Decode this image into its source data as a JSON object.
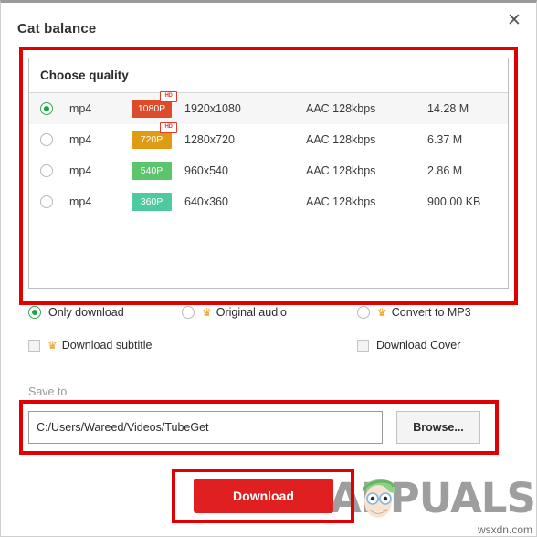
{
  "window": {
    "title": "Cat  balance",
    "close_icon": "close-icon"
  },
  "quality": {
    "header": "Choose quality",
    "columns": [
      "format",
      "quality_badge",
      "resolution",
      "audio",
      "size"
    ],
    "rows": [
      {
        "selected": true,
        "format": "mp4",
        "badge": "1080P",
        "badge_color": "#dc4b2a",
        "hd_tag": "HD",
        "resolution": "1920x1080",
        "audio": "AAC 128kbps",
        "size": "14.28 M"
      },
      {
        "selected": false,
        "format": "mp4",
        "badge": "720P",
        "badge_color": "#e09b14",
        "hd_tag": "HD",
        "resolution": "1280x720",
        "audio": "AAC 128kbps",
        "size": "6.37 M"
      },
      {
        "selected": false,
        "format": "mp4",
        "badge": "540P",
        "badge_color": "#5cc46b",
        "hd_tag": "",
        "resolution": "960x540",
        "audio": "AAC 128kbps",
        "size": "2.86 M"
      },
      {
        "selected": false,
        "format": "mp4",
        "badge": "360P",
        "badge_color": "#4ec9a0",
        "hd_tag": "",
        "resolution": "640x360",
        "audio": "AAC 128kbps",
        "size": "900.00 KB"
      }
    ]
  },
  "options": {
    "mode_radios": [
      {
        "label": "Only download",
        "selected": true,
        "crown": false
      },
      {
        "label": "Original audio",
        "selected": false,
        "crown": true
      },
      {
        "label": "Convert to MP3",
        "selected": false,
        "crown": true
      }
    ],
    "checkboxes": [
      {
        "label": "Download subtitle",
        "checked": false,
        "crown": true
      },
      {
        "label": "Download Cover",
        "checked": false,
        "crown": false
      }
    ],
    "crown_icon": "crown-icon",
    "crown_glyph": "♛",
    "crown_color": "#f0a020"
  },
  "save": {
    "label": "Save to",
    "path": "C:/Users/Wareed/Videos/TubeGet",
    "placeholder": "C:/Users/Wareed/Videos/TubeGet",
    "browse_label": "Browse..."
  },
  "actions": {
    "download_label": "Download",
    "download_color": "#e02020"
  },
  "annotations": {
    "highlight_color": "#e00000",
    "boxes": [
      "quality-panel",
      "save-to-row",
      "download-button"
    ]
  },
  "watermark": {
    "brand": "APPUALS",
    "brand_prefix": "A",
    "brand_suffix": "PUALS",
    "domain": "wsxdn.com"
  }
}
